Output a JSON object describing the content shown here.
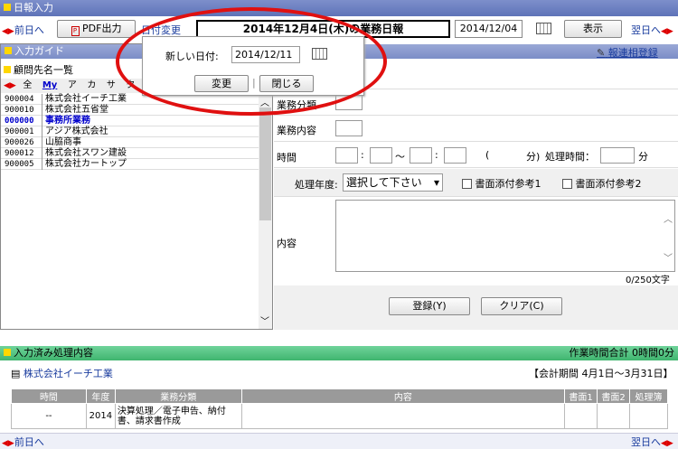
{
  "window": {
    "title": "日報入力"
  },
  "toolbar": {
    "prev_day": "前日へ",
    "pdf_output": "PDF出力",
    "date_change": "日付変更",
    "report_title": "2014年12月4日(木)の業務日報",
    "current_date": "2014/12/04",
    "show_button": "表示",
    "next_day": "翌日へ"
  },
  "popup": {
    "label": "新しい日付:",
    "date_value": "2014/12/11",
    "change_button": "変更",
    "close_button": "閉じる"
  },
  "input_guide": {
    "title": "入力ガイド",
    "client_list_title": "顧問先名一覧",
    "tabs": [
      "全",
      "My",
      "ア",
      "カ",
      "サ",
      "タ"
    ],
    "clients": [
      {
        "code": "900004",
        "name": "株式会社イーチ工業"
      },
      {
        "code": "900010",
        "name": "株式会社五省堂"
      },
      {
        "code": "000000",
        "name": "事務所業務",
        "selected": true
      },
      {
        "code": "900001",
        "name": "アジア株式会社"
      },
      {
        "code": "900026",
        "name": "山脇商事"
      },
      {
        "code": "900012",
        "name": "株式会社スワン建設"
      },
      {
        "code": "900005",
        "name": "株式会社カートップ"
      }
    ]
  },
  "form": {
    "quick_register": "報連相登録",
    "work_category_label": "業務分類",
    "work_content_label": "業務内容",
    "time_label": "時間",
    "time_tilde": "〜",
    "minutes_open": "(",
    "minutes_unit": "分)",
    "processing_time_label": "処理時間：",
    "processing_time_unit": "分",
    "fiscal_year_label": "処理年度:",
    "fiscal_year_select": "選択して下さい",
    "attach_ref1": "書面添付参考1",
    "attach_ref2": "書面添付参考2",
    "content_label": "内容",
    "char_count": "0/250文字",
    "register_button": "登録(Y)",
    "clear_button": "クリア(C)"
  },
  "completed": {
    "title": "入力済み処理内容",
    "work_time_total": "作業時間合計 0時間0分",
    "company": "株式会社イーチ工業",
    "accounting_period": "【会計期間 4月1日〜3月31日】",
    "columns": [
      "時間",
      "年度",
      "業務分類",
      "内容",
      "書面1",
      "書面2",
      "処理簿"
    ],
    "rows": [
      {
        "time": "--",
        "year": "2014",
        "category": "決算処理／電子申告、納付書、請求書作成",
        "content": "",
        "doc1": "",
        "doc2": "",
        "book": ""
      }
    ]
  },
  "footer": {
    "prev_day": "前日へ",
    "next_day": "翌日へ"
  }
}
